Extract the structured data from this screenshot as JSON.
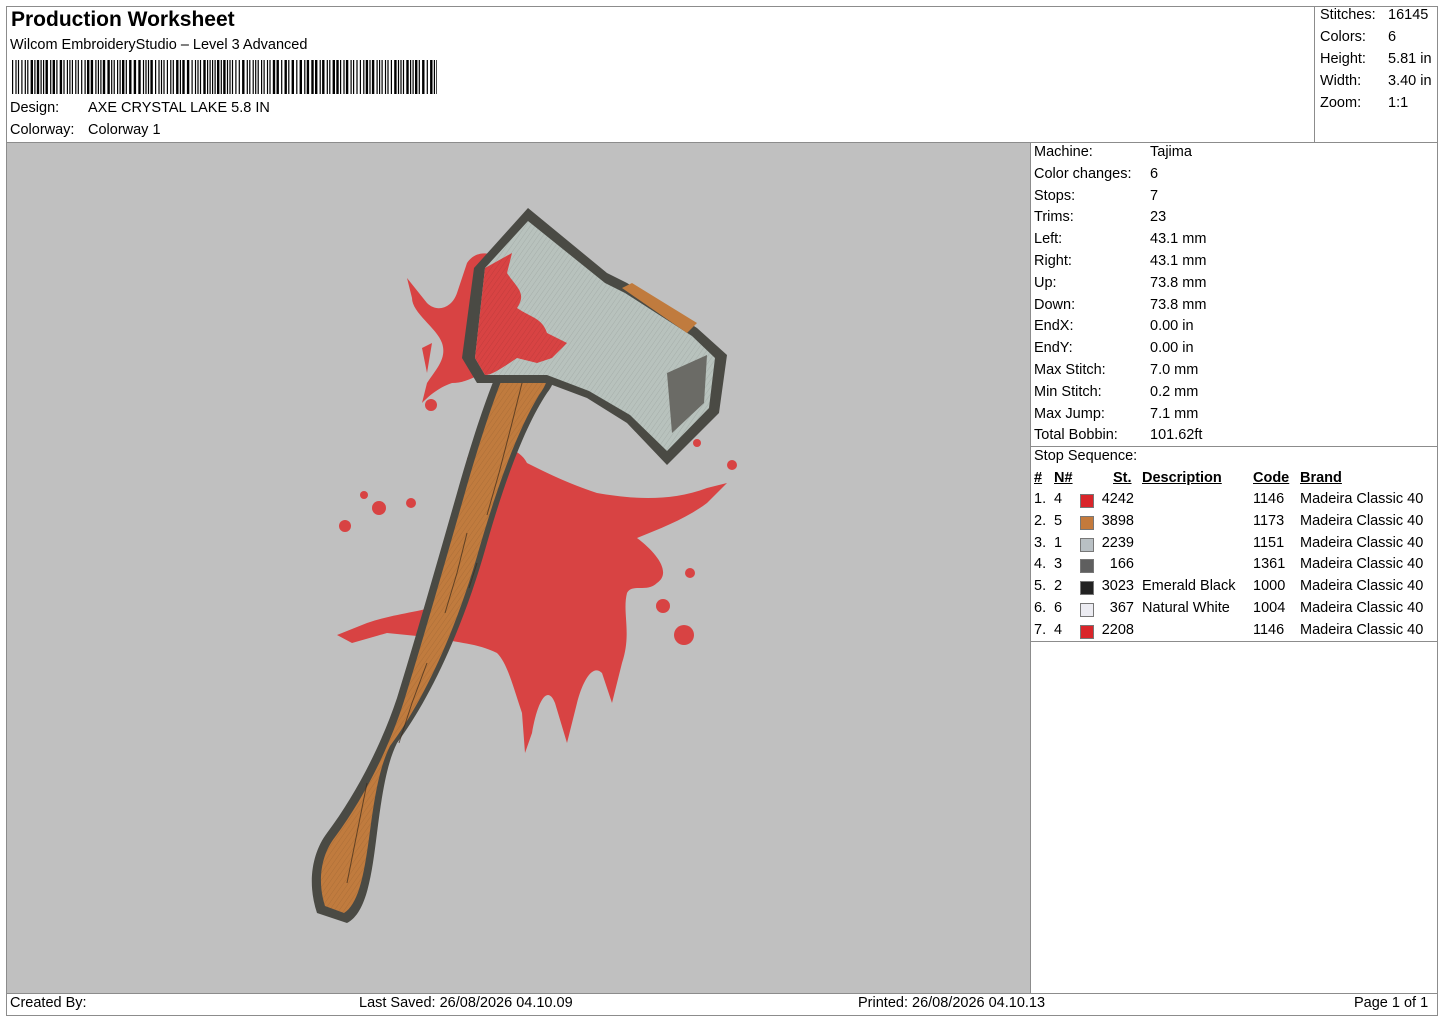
{
  "header": {
    "title": "Production Worksheet",
    "software": "Wilcom EmbroideryStudio – Level 3 Advanced",
    "design_label": "Design:",
    "design_value": "AXE CRYSTAL LAKE 5.8 IN",
    "colorway_label": "Colorway:",
    "colorway_value": "Colorway 1"
  },
  "stats": [
    {
      "label": "Stitches:",
      "value": "16145"
    },
    {
      "label": "Colors:",
      "value": "6"
    },
    {
      "label": "Height:",
      "value": "5.81 in"
    },
    {
      "label": "Width:",
      "value": "3.40 in"
    },
    {
      "label": "Zoom:",
      "value": "1:1"
    }
  ],
  "machine_info": [
    {
      "label": "Machine:",
      "value": "Tajima"
    },
    {
      "label": "Color changes:",
      "value": "6"
    },
    {
      "label": "Stops:",
      "value": "7"
    },
    {
      "label": "Trims:",
      "value": "23"
    },
    {
      "label": "Left:",
      "value": "43.1 mm"
    },
    {
      "label": "Right:",
      "value": "43.1 mm"
    },
    {
      "label": "Up:",
      "value": "73.8 mm"
    },
    {
      "label": "Down:",
      "value": "73.8 mm"
    },
    {
      "label": "EndX:",
      "value": "0.00 in"
    },
    {
      "label": "EndY:",
      "value": "0.00 in"
    },
    {
      "label": "Max Stitch:",
      "value": "7.0 mm"
    },
    {
      "label": "Min Stitch:",
      "value": "0.2 mm"
    },
    {
      "label": "Max Jump:",
      "value": "7.1 mm"
    },
    {
      "label": "Total Bobbin:",
      "value": "101.62ft"
    }
  ],
  "stop_sequence": {
    "title": "Stop Sequence:",
    "columns": {
      "idx": "#",
      "n": "N#",
      "st": "St.",
      "description": "Description",
      "code": "Code",
      "brand": "Brand"
    },
    "rows": [
      {
        "idx": "1.",
        "n": "4",
        "color": "#d9252a",
        "st": "4242",
        "description": "",
        "code": "1146",
        "brand": "Madeira Classic 40"
      },
      {
        "idx": "2.",
        "n": "5",
        "color": "#c47a3c",
        "st": "3898",
        "description": "",
        "code": "1173",
        "brand": "Madeira Classic 40"
      },
      {
        "idx": "3.",
        "n": "1",
        "color": "#b9c0c4",
        "st": "2239",
        "description": "",
        "code": "1151",
        "brand": "Madeira Classic 40"
      },
      {
        "idx": "4.",
        "n": "3",
        "color": "#5f5f5f",
        "st": "166",
        "description": "",
        "code": "1361",
        "brand": "Madeira Classic 40"
      },
      {
        "idx": "5.",
        "n": "2",
        "color": "#222222",
        "st": "3023",
        "description": "Emerald Black",
        "code": "1000",
        "brand": "Madeira Classic 40"
      },
      {
        "idx": "6.",
        "n": "6",
        "color": "#ececf2",
        "st": "367",
        "description": "Natural White",
        "code": "1004",
        "brand": "Madeira Classic 40"
      },
      {
        "idx": "7.",
        "n": "4",
        "color": "#d9252a",
        "st": "2208",
        "description": "",
        "code": "1146",
        "brand": "Madeira Classic 40"
      }
    ]
  },
  "footer": {
    "created_by": "Created By:",
    "last_saved": "Last Saved: 26/08/2026 04.10.09",
    "printed": "Printed: 26/08/2026 04.10.13",
    "page": "Page 1 of 1"
  },
  "design_preview": {
    "icon": "axe-embroidery-icon",
    "background": "#c0c0c0",
    "blood": "#d84343",
    "handle": "#c07b3e",
    "blade": "#b8c2bd",
    "outline": "#4a4a44"
  }
}
